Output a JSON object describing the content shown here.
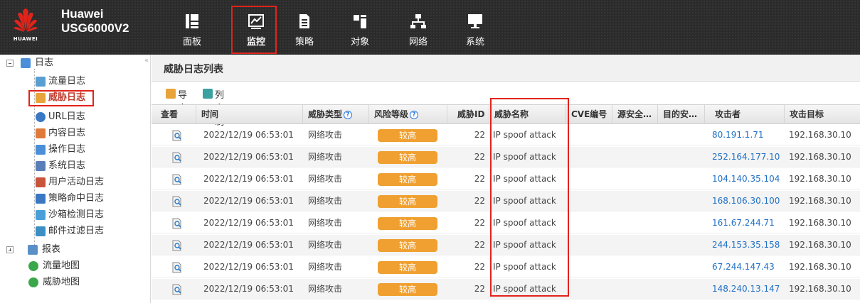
{
  "brand": {
    "logo_text": "HUAWEI",
    "name": "Huawei",
    "model": "USG6000V2"
  },
  "nav": [
    {
      "label": "面板",
      "icon": "dashboard-icon",
      "active": false
    },
    {
      "label": "监控",
      "icon": "monitor-icon",
      "active": true
    },
    {
      "label": "策略",
      "icon": "policy-icon",
      "active": false
    },
    {
      "label": "对象",
      "icon": "object-icon",
      "active": false
    },
    {
      "label": "网络",
      "icon": "network-icon",
      "active": false
    },
    {
      "label": "系统",
      "icon": "system-icon",
      "active": false
    }
  ],
  "tree": {
    "log_root": "日志",
    "log_items": [
      "流量日志",
      "威胁日志",
      "URL日志",
      "内容日志",
      "操作日志",
      "系统日志",
      "用户活动日志",
      "策略命中日志",
      "沙箱检测日志",
      "邮件过滤日志"
    ],
    "report_root": "报表",
    "report_items": [
      "流量地图",
      "威胁地图"
    ],
    "selected": "威胁日志",
    "collapse_glyph": "«"
  },
  "panel": {
    "title": "威胁日志列表",
    "toolbar": {
      "export_label": "导出",
      "columns_label": "列定制"
    },
    "columns": [
      "查看",
      "时间",
      "威胁类型",
      "风险等级",
      "威胁ID",
      "威胁名称",
      "CVE编号",
      "源安全…",
      "目的安…",
      "攻击者",
      "攻击目标"
    ],
    "help_glyph": "?",
    "rows": [
      {
        "time": "2022/12/19 06:53:01",
        "type": "网络攻击",
        "risk": "较高",
        "id": "22",
        "name": "IP spoof attack",
        "attacker": "80.191.1.71",
        "target": "192.168.30.10"
      },
      {
        "time": "2022/12/19 06:53:01",
        "type": "网络攻击",
        "risk": "较高",
        "id": "22",
        "name": "IP spoof attack",
        "attacker": "252.164.177.10",
        "target": "192.168.30.10"
      },
      {
        "time": "2022/12/19 06:53:01",
        "type": "网络攻击",
        "risk": "较高",
        "id": "22",
        "name": "IP spoof attack",
        "attacker": "104.140.35.104",
        "target": "192.168.30.10"
      },
      {
        "time": "2022/12/19 06:53:01",
        "type": "网络攻击",
        "risk": "较高",
        "id": "22",
        "name": "IP spoof attack",
        "attacker": "168.106.30.100",
        "target": "192.168.30.10"
      },
      {
        "time": "2022/12/19 06:53:01",
        "type": "网络攻击",
        "risk": "较高",
        "id": "22",
        "name": "IP spoof attack",
        "attacker": "161.67.244.71",
        "target": "192.168.30.10"
      },
      {
        "time": "2022/12/19 06:53:01",
        "type": "网络攻击",
        "risk": "较高",
        "id": "22",
        "name": "IP spoof attack",
        "attacker": "244.153.35.158",
        "target": "192.168.30.10"
      },
      {
        "time": "2022/12/19 06:53:01",
        "type": "网络攻击",
        "risk": "较高",
        "id": "22",
        "name": "IP spoof attack",
        "attacker": "67.244.147.43",
        "target": "192.168.30.10"
      },
      {
        "time": "2022/12/19 06:53:01",
        "type": "网络攻击",
        "risk": "较高",
        "id": "22",
        "name": "IP spoof attack",
        "attacker": "148.240.13.147",
        "target": "192.168.30.10"
      }
    ]
  },
  "colors": {
    "highlight": "#e0241b",
    "risk_badge": "#f0a030",
    "link": "#1f6fc5",
    "topbar": "#2b2b2b"
  }
}
